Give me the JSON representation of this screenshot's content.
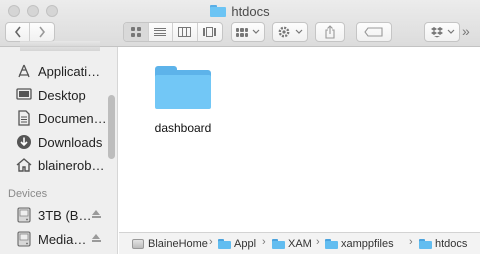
{
  "window": {
    "title": "htdocs"
  },
  "toolbar": {
    "back_icon": "chevron-left-icon",
    "forward_icon": "chevron-right-icon",
    "action_icon": "gear-icon",
    "share_icon": "share-icon",
    "tag_icon": "tag-icon",
    "dropbox_icon": "dropbox-icon",
    "overflow_label": "»"
  },
  "sidebar": {
    "items": [
      {
        "label": "Applicati…",
        "icon": "applications-icon"
      },
      {
        "label": "Desktop",
        "icon": "desktop-icon"
      },
      {
        "label": "Documen…",
        "icon": "document-icon"
      },
      {
        "label": "Downloads",
        "icon": "download-icon"
      },
      {
        "label": "blainerob…",
        "icon": "home-icon"
      }
    ],
    "devices_header": "Devices",
    "devices": [
      {
        "label": "3TB (B…",
        "icon": "hard-drive-icon"
      },
      {
        "label": "Media…",
        "icon": "hard-drive-icon"
      }
    ]
  },
  "main": {
    "folders": [
      {
        "name": "dashboard"
      }
    ]
  },
  "pathbar": {
    "crumbs": [
      "BlaineHome",
      "Appl",
      "XAM",
      "xamppfiles",
      "htdocs"
    ],
    "separator": "›"
  },
  "colors": {
    "folder": "#72c7f6",
    "sidebar_bg": "#efefef",
    "toolbar_bg": "#e2e2e2"
  }
}
